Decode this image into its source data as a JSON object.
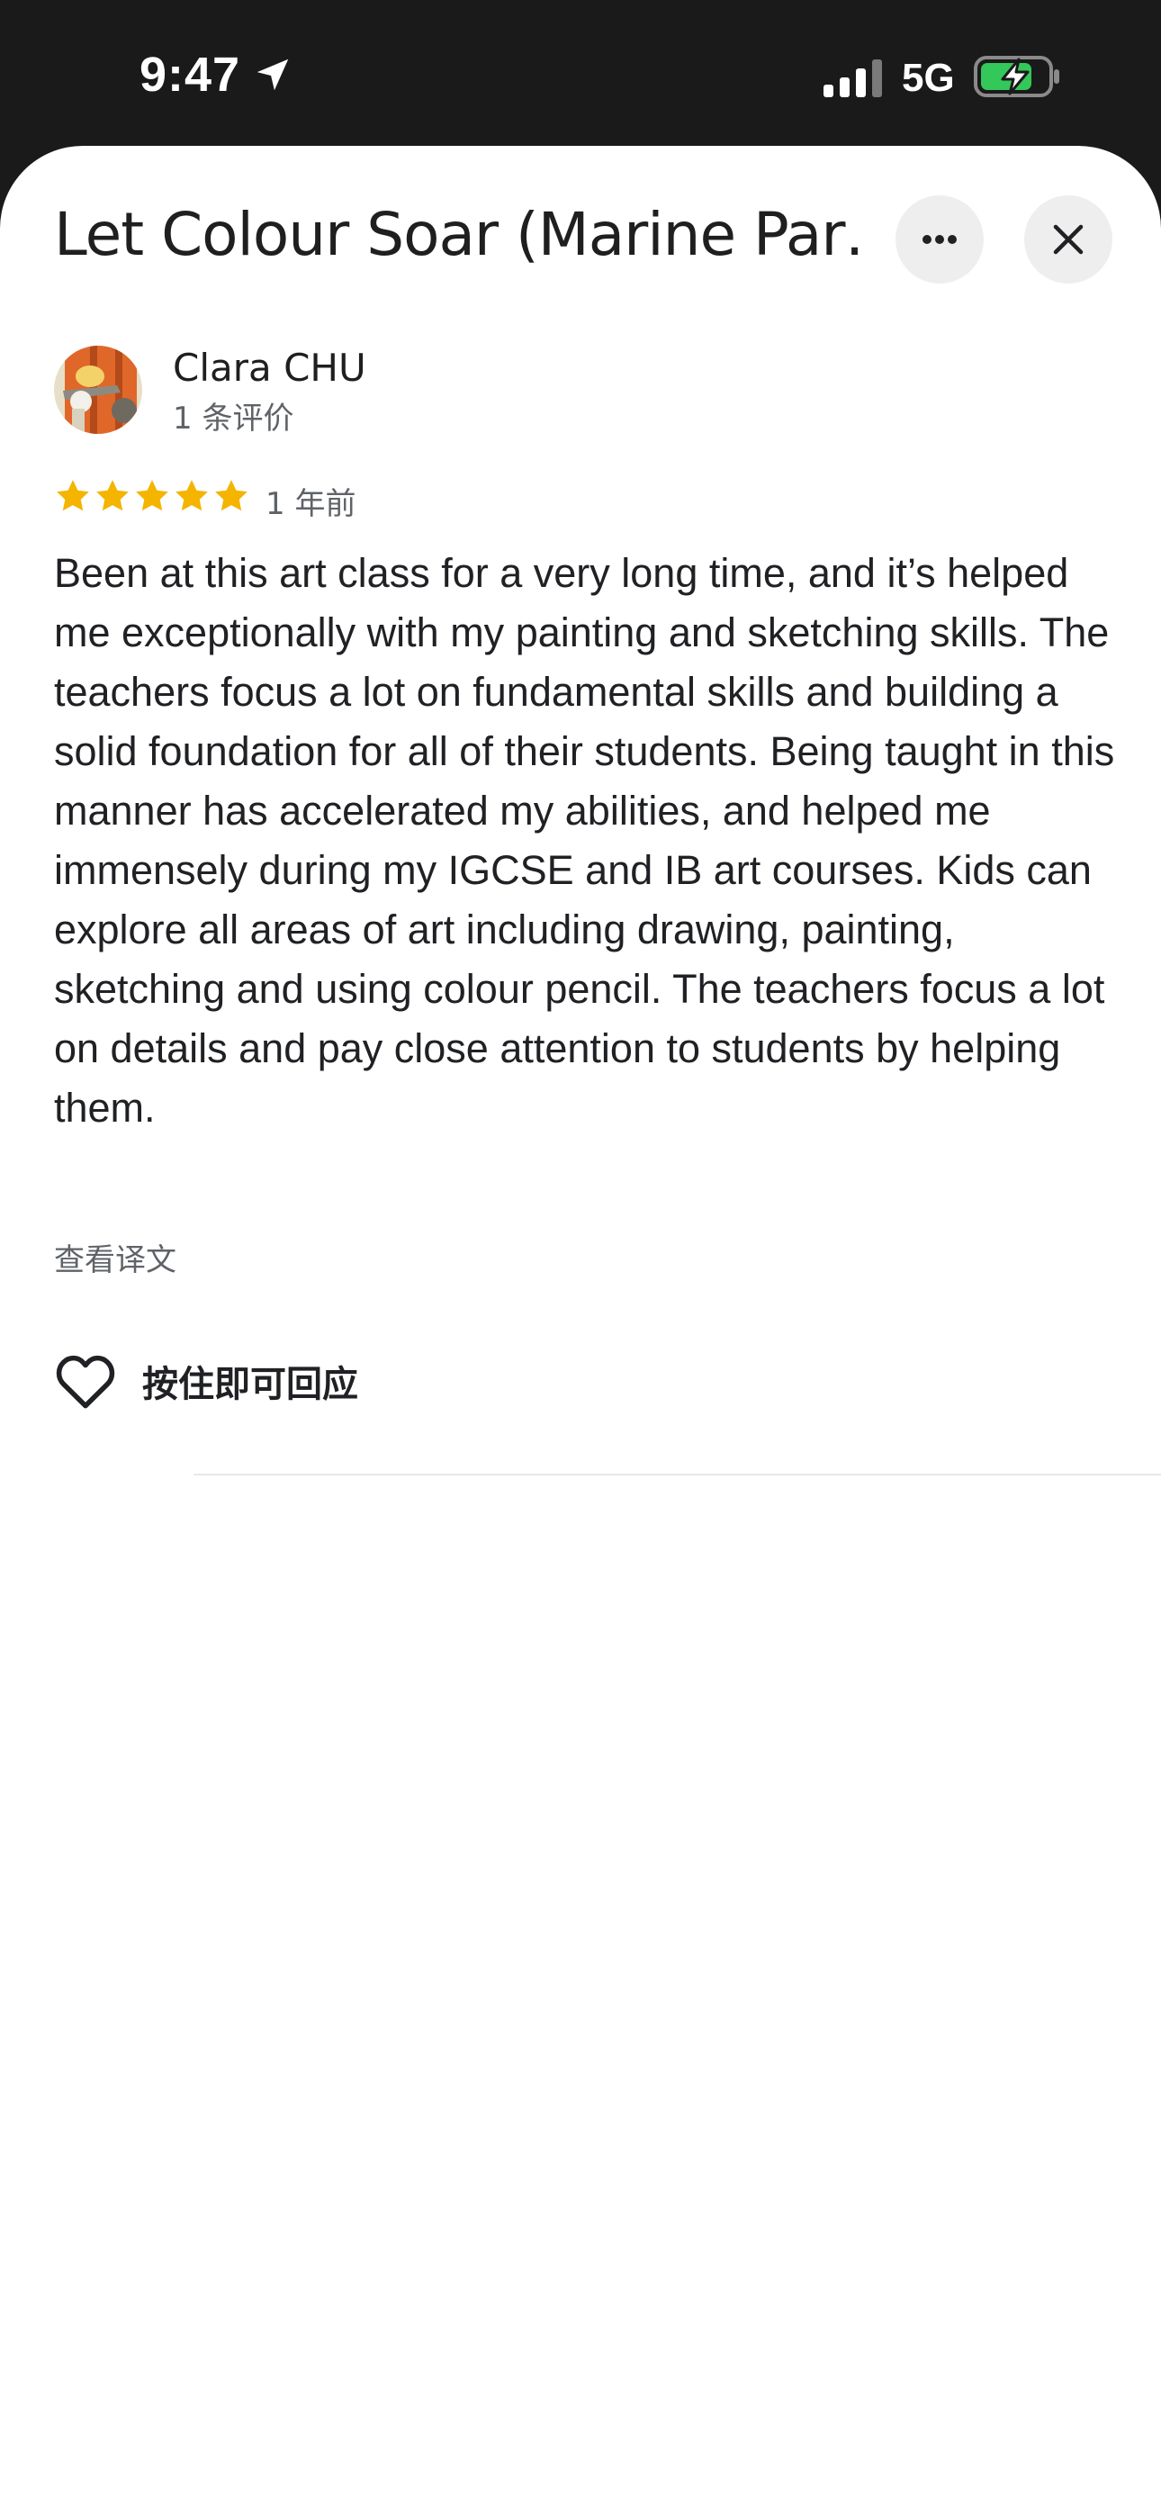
{
  "status_bar": {
    "time": "9:47",
    "network": "5G",
    "icons": [
      "location-arrow-icon",
      "cellular-signal-icon",
      "battery-charging-icon"
    ]
  },
  "sheet": {
    "title": "Let Colour Soar (Marine Par…",
    "more_button_icon": "more-horizontal-icon",
    "close_button_icon": "close-icon"
  },
  "review": {
    "reviewer_name": "Clara CHU",
    "review_count": "1 条评价",
    "rating": 5,
    "rating_max": 5,
    "age": "1 年前",
    "text": "Been at this art class for a very long time, and it’s helped me exceptionally with my painting and sketching skills. The teachers focus a lot on fundamental skills and building a solid foundation for all of their students. Being taught in this manner has accelerated my abilities, and helped me immensely during my IGCSE and IB art courses. Kids can explore all areas of art including drawing, painting, sketching and using colour pencil. The teachers focus a lot on details and pay close attention to students by helping them.",
    "translate_link": "查看译文",
    "like_label": "按住即可回应"
  },
  "colors": {
    "star": "#f4b400",
    "status_bar_bg": "#1a1a1a",
    "battery_fill": "#34c759",
    "sheet_bg": "#ffffff"
  }
}
